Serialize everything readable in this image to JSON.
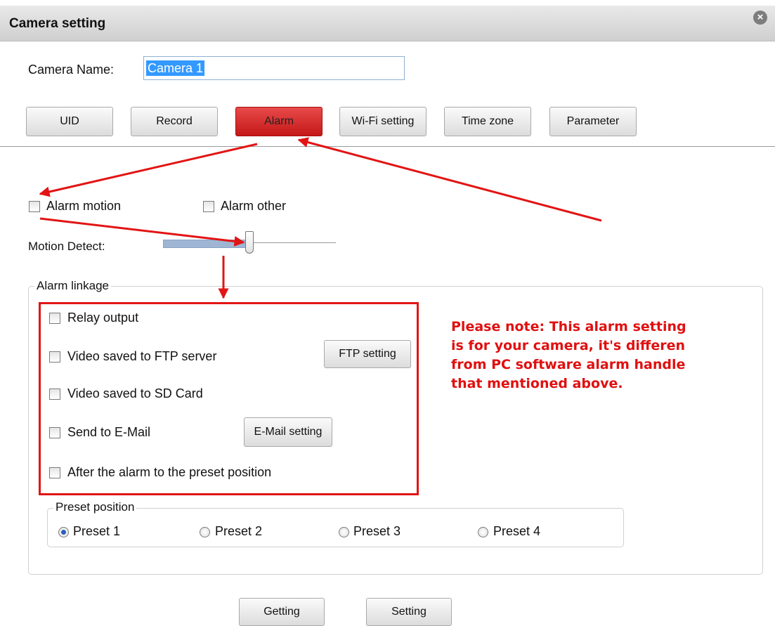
{
  "window": {
    "title": "Camera setting",
    "close_icon": "close-icon"
  },
  "camera_name": {
    "label": "Camera Name:",
    "value": "Camera 1"
  },
  "tabs": [
    {
      "label": "UID"
    },
    {
      "label": "Record"
    },
    {
      "label": "Alarm",
      "active": true
    },
    {
      "label": "Wi-Fi setting"
    },
    {
      "label": "Time zone"
    },
    {
      "label": "Parameter"
    }
  ],
  "alarm": {
    "motion_label": "Alarm motion",
    "other_label": "Alarm other",
    "motion_detect_label": "Motion Detect:",
    "motion_detect_level": 0.5
  },
  "linkage": {
    "legend": "Alarm linkage",
    "relay_label": "Relay output",
    "ftp_label": "Video saved to FTP server",
    "ftp_button": "FTP setting",
    "sd_label": "Video saved to SD Card",
    "email_label": "Send to E-Mail",
    "email_button": "E-Mail setting",
    "preset_after_label": "After the alarm to the preset position"
  },
  "preset": {
    "legend": "Preset position",
    "options": [
      "Preset 1",
      "Preset 2",
      "Preset 3",
      "Preset 4"
    ],
    "selected": "Preset 1"
  },
  "note": {
    "lines": [
      "Please note: This alarm setting",
      "is for your camera, it's differen",
      "from PC software alarm handle",
      "that mentioned above."
    ],
    "color": "#e01010"
  },
  "actions": {
    "getting": "Getting",
    "setting": "Setting"
  },
  "colors": {
    "active_tab": "#d42020",
    "annotation": "#e21414",
    "selection": "#3399ff"
  }
}
